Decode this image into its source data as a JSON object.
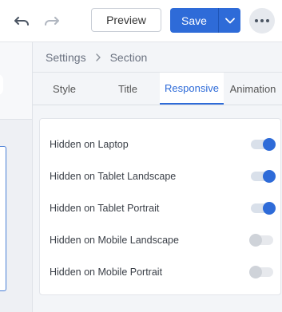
{
  "toolbar": {
    "undo_icon": "undo-icon",
    "redo_icon": "redo-icon",
    "preview_label": "Preview",
    "save_label": "Save",
    "save_dropdown_icon": "chevron-down-icon",
    "more_icon": "more-horizontal-icon"
  },
  "breadcrumb": {
    "items": [
      "Settings",
      "Section"
    ],
    "separator_icon": "chevron-right-icon"
  },
  "tabs": {
    "items": [
      "Style",
      "Title",
      "Responsive",
      "Animation"
    ],
    "active": "Responsive"
  },
  "settings": {
    "rows": [
      {
        "label": "Hidden on Laptop",
        "enabled": true
      },
      {
        "label": "Hidden on Tablet Landscape",
        "enabled": true
      },
      {
        "label": "Hidden on Tablet Portrait",
        "enabled": true
      },
      {
        "label": "Hidden on Mobile Landscape",
        "enabled": false
      },
      {
        "label": "Hidden on Mobile Portrait",
        "enabled": false
      }
    ]
  },
  "colors": {
    "accent": "#2e6bd8",
    "toggle_off": "#cfd3d9"
  }
}
